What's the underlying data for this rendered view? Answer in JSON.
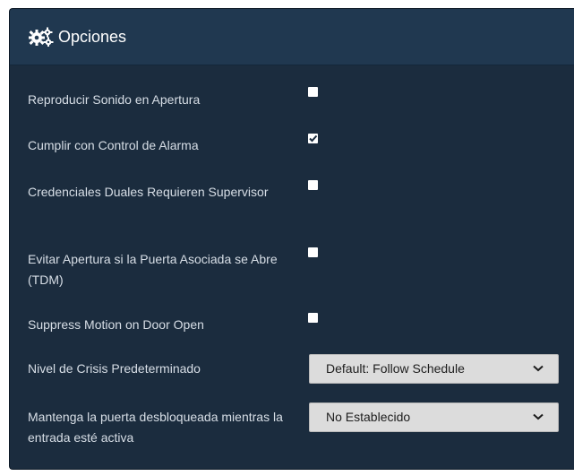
{
  "panel": {
    "title": "Opciones",
    "title_icon": "gears-icon"
  },
  "options": [
    {
      "label": "Reproducir Sonido en Apertura",
      "checked": false
    },
    {
      "label": "Cumplir con Control de Alarma",
      "checked": true
    },
    {
      "label": "Credenciales Duales Requieren Supervisor",
      "checked": false
    },
    {
      "label": "Evitar Apertura si la Puerta Asociada se Abre (TDM)",
      "checked": false
    },
    {
      "label": "Suppress Motion on Door Open",
      "checked": false
    }
  ],
  "selects": [
    {
      "label": "Nivel de Crisis Predeterminado",
      "value": "Default: Follow Schedule"
    },
    {
      "label": "Mantenga la puerta desbloqueada mientras la entrada esté activa",
      "value": "No Establecido"
    }
  ],
  "colors": {
    "panel_bg": "#1b2c3e",
    "header_bg": "#203850",
    "label_text": "#d7dee6",
    "select_bg": "#dcdcdc"
  }
}
